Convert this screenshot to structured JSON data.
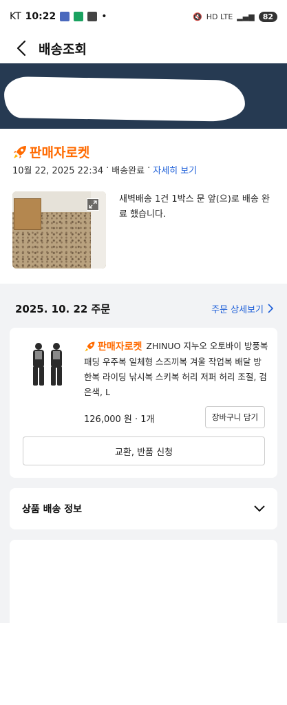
{
  "status_bar": {
    "carrier": "KT",
    "time": "10:22",
    "indicators": "HD LTE",
    "battery": "82"
  },
  "app_bar": {
    "back_icon": "chevron-left-icon",
    "title": "배송조회"
  },
  "delivery": {
    "brand_icon": "rocket-icon",
    "brand": "판매자로켓",
    "datetime": "10월 22, 2025 22:34",
    "separator": "·",
    "status": "배송완료",
    "detail_link": "자세히 보기",
    "expand_icon": "expand-icon",
    "message": "새벽배송 1건 1박스 문 앞(으)로 배송 완료 했습니다."
  },
  "order": {
    "date": "2025. 10. 22 주문",
    "detail_link": "주문 상세보기",
    "product": {
      "brand": "판매자로켓",
      "name": "ZHINUO 지누오 오토바이 방풍복 패딩 우주복 일체형 스즈끼복 겨울 작업복 배달 방한복 라이딩 낚시복 스키복 허리 저퍼 허리 조절, 검은색, L",
      "price": "126,000 원",
      "quantity": "1개",
      "cart_button": "장바구니 담기"
    },
    "return_button": "교환, 반품 신청"
  },
  "shipping_info": {
    "title": "상품 배송 정보",
    "toggle_icon": "chevron-down-icon"
  },
  "colors": {
    "accent_orange": "#ff6a00",
    "link_blue": "#1a5dd8",
    "banner_navy": "#263a52"
  }
}
